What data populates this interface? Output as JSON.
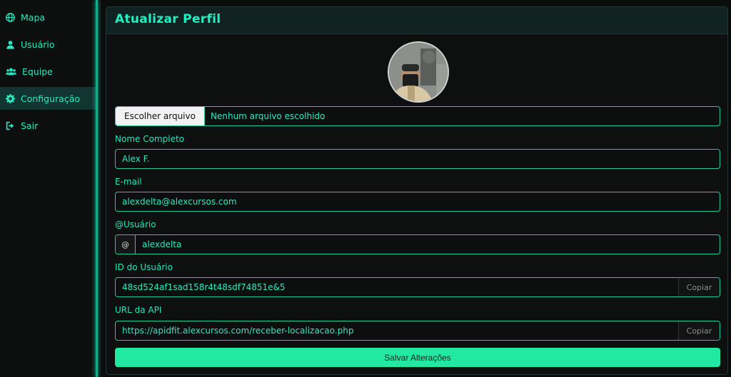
{
  "sidebar": {
    "items": [
      {
        "label": "Mapa",
        "icon": "globe-icon"
      },
      {
        "label": "Usuário",
        "icon": "user-icon"
      },
      {
        "label": "Equipe",
        "icon": "users-icon"
      },
      {
        "label": "Configuração",
        "icon": "gear-icon",
        "active": true
      },
      {
        "label": "Sair",
        "icon": "sign-out-icon"
      }
    ]
  },
  "card": {
    "title": "Atualizar Perfil",
    "file": {
      "button_label": "Escolher arquivo",
      "status": "Nenhum arquivo escolhido"
    },
    "full_name": {
      "label": "Nome Completo",
      "value": "Alex F."
    },
    "email": {
      "label": "E-mail",
      "value": "alexdelta@alexcursos.com"
    },
    "username": {
      "label": "@Usuário",
      "prefix": "@",
      "value": "alexdelta"
    },
    "user_id": {
      "label": "ID do Usuário",
      "value": "48sd524af1sad158r4t48sdf74851e&5",
      "copy_label": "Copiar"
    },
    "api_url": {
      "label": "URL da API",
      "value": "https://apidfit.alexcursos.com/receber-localizacao.php",
      "copy_label": "Copiar"
    },
    "save_label": "Salvar Alterações"
  },
  "colors": {
    "accent": "#1fe0b4",
    "button": "#21e9a3",
    "background": "#0b0c0c"
  }
}
